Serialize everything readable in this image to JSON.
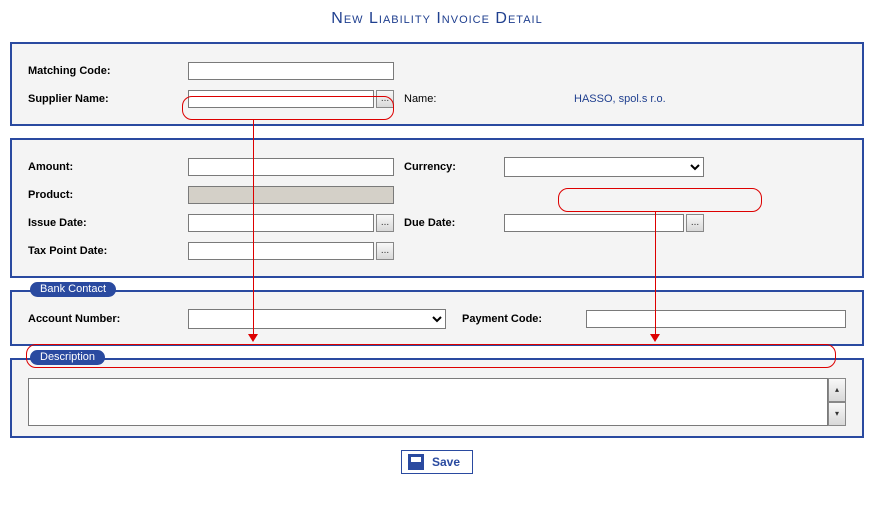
{
  "title": "New Liability Invoice Detail",
  "section1": {
    "matching_code_label": "Matching Code:",
    "matching_code_value": "",
    "supplier_name_label": "Supplier Name:",
    "supplier_name_value": "",
    "name_label": "Name:",
    "name_value": "HASSO, spol.s r.o."
  },
  "section2": {
    "amount_label": "Amount:",
    "amount_value": "",
    "currency_label": "Currency:",
    "currency_value": "",
    "product_label": "Product:",
    "product_value": "",
    "issue_date_label": "Issue Date:",
    "issue_date_value": "",
    "due_date_label": "Due Date:",
    "due_date_value": "",
    "tax_point_label": "Tax Point Date:",
    "tax_point_value": ""
  },
  "bank": {
    "legend": "Bank Contact",
    "account_number_label": "Account Number:",
    "account_number_value": "",
    "payment_code_label": "Payment Code:",
    "payment_code_value": ""
  },
  "description": {
    "legend": "Description",
    "value": ""
  },
  "buttons": {
    "lookup": "...",
    "save": "Save",
    "spin_up": "▴",
    "spin_down": "▾"
  }
}
